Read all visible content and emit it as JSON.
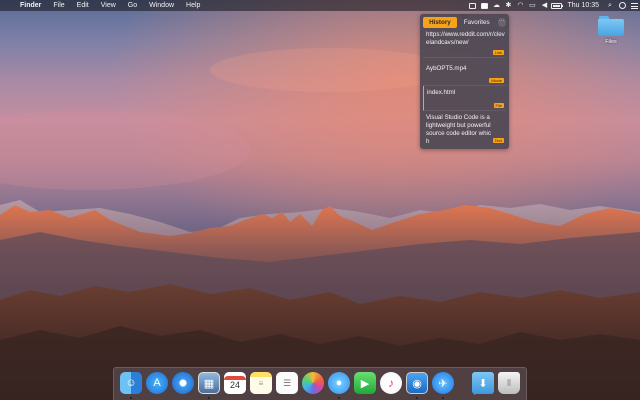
{
  "menubar": {
    "app_name": "Finder",
    "menus": [
      "File",
      "Edit",
      "View",
      "Go",
      "Window",
      "Help"
    ],
    "clock": "Thu 10:35"
  },
  "clipboard": {
    "tabs": {
      "history": "History",
      "favorites": "Favorites"
    },
    "more_label": "···",
    "items": [
      {
        "text": "https://www.reddit.com/r/clevelandcavs/new/",
        "tag": "Link"
      },
      {
        "text": "AybOPT5.mp4",
        "tag": "Movie"
      },
      {
        "text": "index.html",
        "tag": "File"
      },
      {
        "text": "Visual Studio Code is a lightweight but powerful source code editor which",
        "tag": "Text"
      }
    ],
    "accent": "#f6a31a"
  },
  "desktop": {
    "icon_label": "Files"
  },
  "dock": {
    "apps": [
      "finder",
      "app-store",
      "safari",
      "preview",
      "calendar",
      "notes",
      "reminders",
      "photos",
      "messages",
      "facetime",
      "music",
      "notchmeister",
      "testflight",
      "downloads",
      "trash"
    ],
    "calendar_day": "24"
  }
}
